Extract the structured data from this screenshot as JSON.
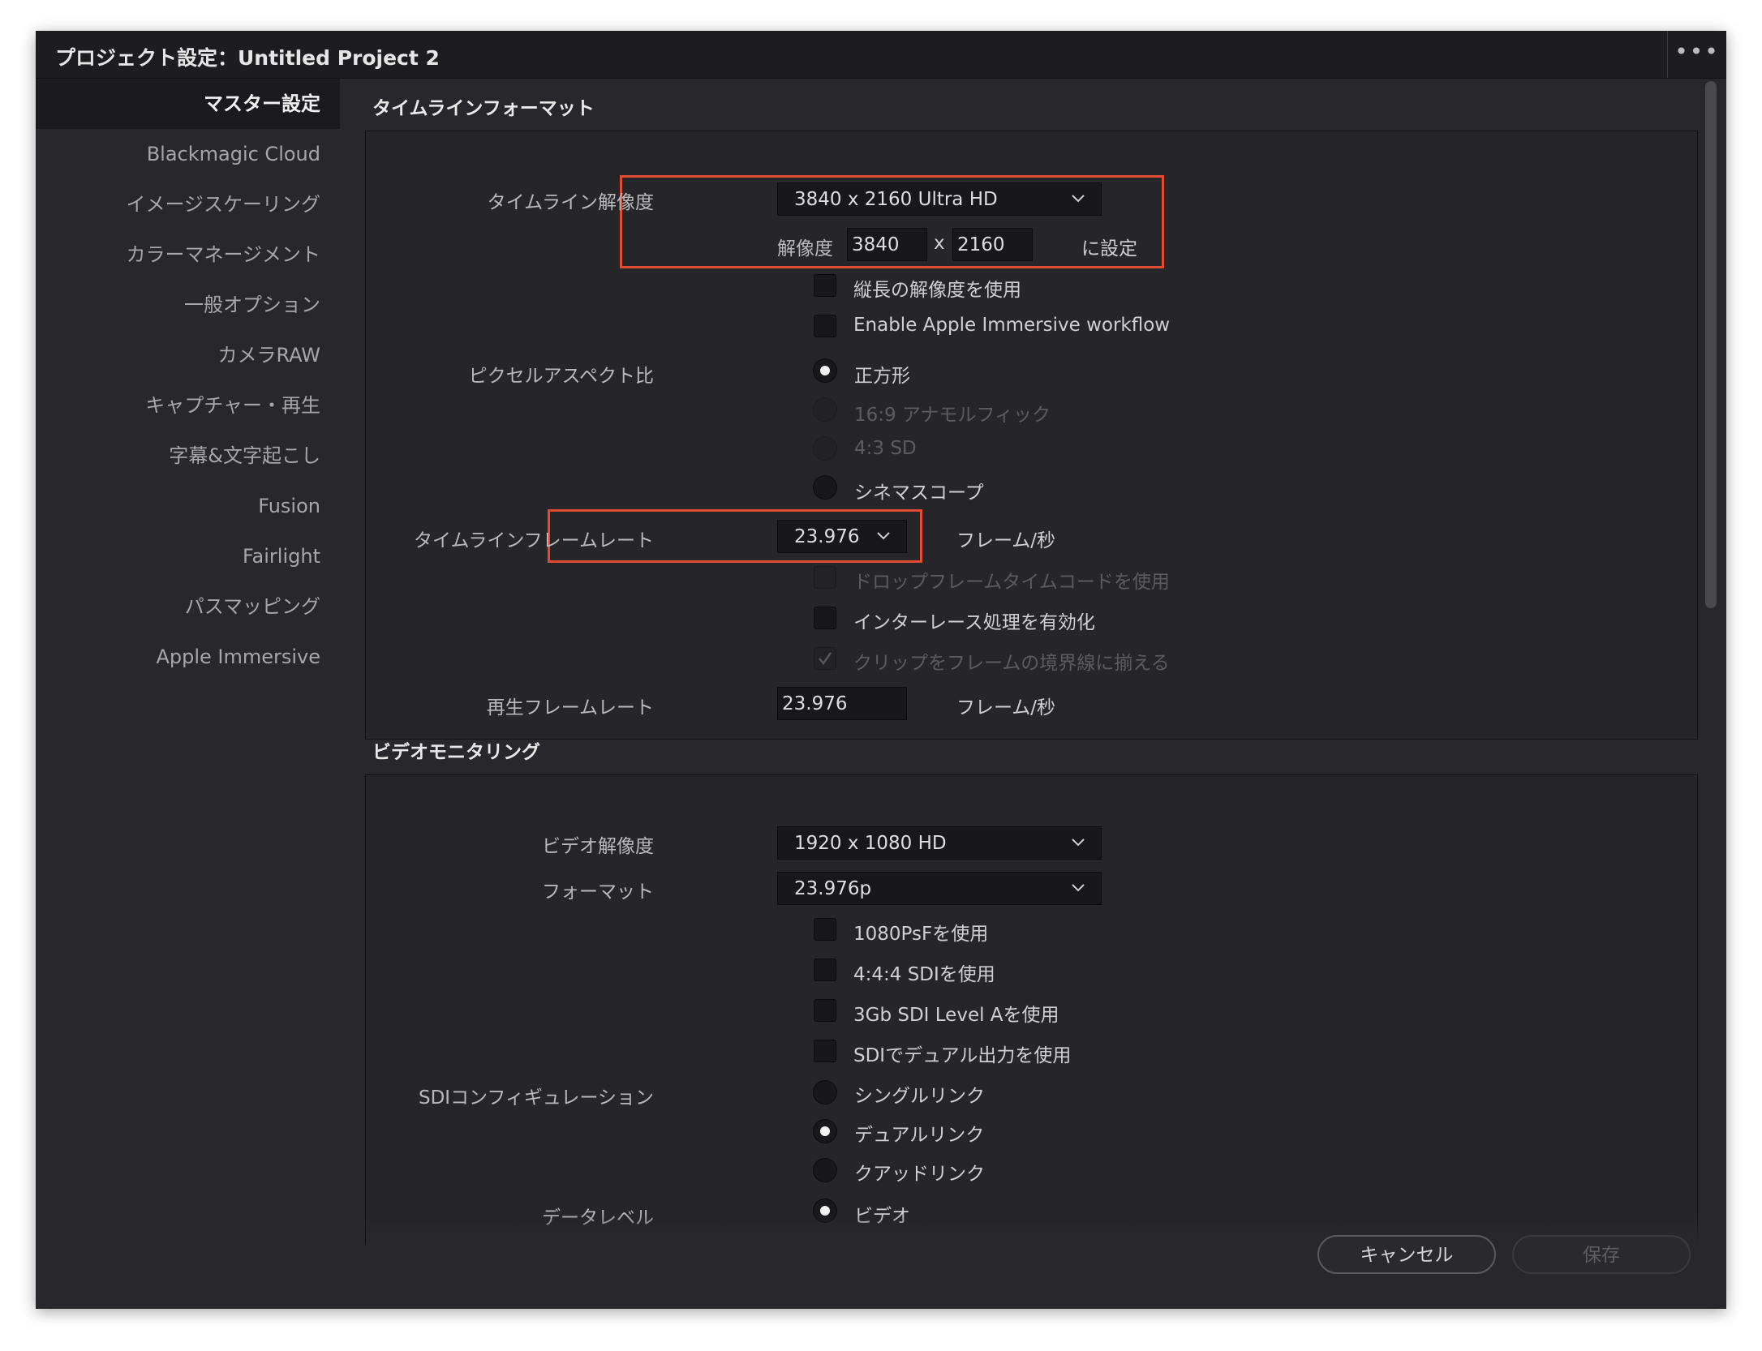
{
  "window": {
    "title": "プロジェクト設定：Untitled Project 2",
    "more_glyph": "•••"
  },
  "sidebar": {
    "items": [
      {
        "label": "マスター設定"
      },
      {
        "label": "Blackmagic Cloud"
      },
      {
        "label": "イメージスケーリング"
      },
      {
        "label": "カラーマネージメント"
      },
      {
        "label": "一般オプション"
      },
      {
        "label": "カメラRAW"
      },
      {
        "label": "キャプチャー・再生"
      },
      {
        "label": "字幕&文字起こし"
      },
      {
        "label": "Fusion"
      },
      {
        "label": "Fairlight"
      },
      {
        "label": "パスマッピング"
      },
      {
        "label": "Apple Immersive"
      }
    ],
    "active_index": 0
  },
  "timeline": {
    "section_title": "タイムラインフォーマット",
    "resolution_label": "タイムライン解像度",
    "resolution_value": "3840 x 2160 Ultra HD",
    "res_label": "解像度",
    "res_width": "3840",
    "res_x": "x",
    "res_height": "2160",
    "res_set": "に設定",
    "vertical_res": "縦長の解像度を使用",
    "apple_immersive": "Enable Apple Immersive workflow",
    "pixel_aspect_label": "ピクセルアスペクト比",
    "aspect_square": "正方形",
    "aspect_169": "16:9 アナモルフィック",
    "aspect_43": "4:3 SD",
    "aspect_cinemascope": "シネマスコープ",
    "framerate_label": "タイムラインフレームレート",
    "framerate_value": "23.976",
    "fps_unit": "フレーム/秒",
    "drop_frame": "ドロップフレームタイムコードを使用",
    "interlace": "インターレース処理を有効化",
    "clip_align": "クリップをフレームの境界線に揃える",
    "playback_label": "再生フレームレート",
    "playback_value": "23.976",
    "playback_unit": "フレーム/秒"
  },
  "video": {
    "section_title": "ビデオモニタリング",
    "resolution_label": "ビデオ解像度",
    "resolution_value": "1920 x 1080 HD",
    "format_label": "フォーマット",
    "format_value": "23.976p",
    "psf": "1080PsFを使用",
    "sdi444": "4:4:4 SDIを使用",
    "level_a": "3Gb SDI Level Aを使用",
    "dual_out": "SDIでデュアル出力を使用",
    "sdi_config_label": "SDIコンフィギュレーション",
    "single_link": "シングルリンク",
    "dual_link": "デュアルリンク",
    "quad_link": "クアッドリンク",
    "data_level_label": "データレベル",
    "data_video": "ビデオ"
  },
  "footer": {
    "cancel": "キャンセル",
    "save": "保存"
  }
}
